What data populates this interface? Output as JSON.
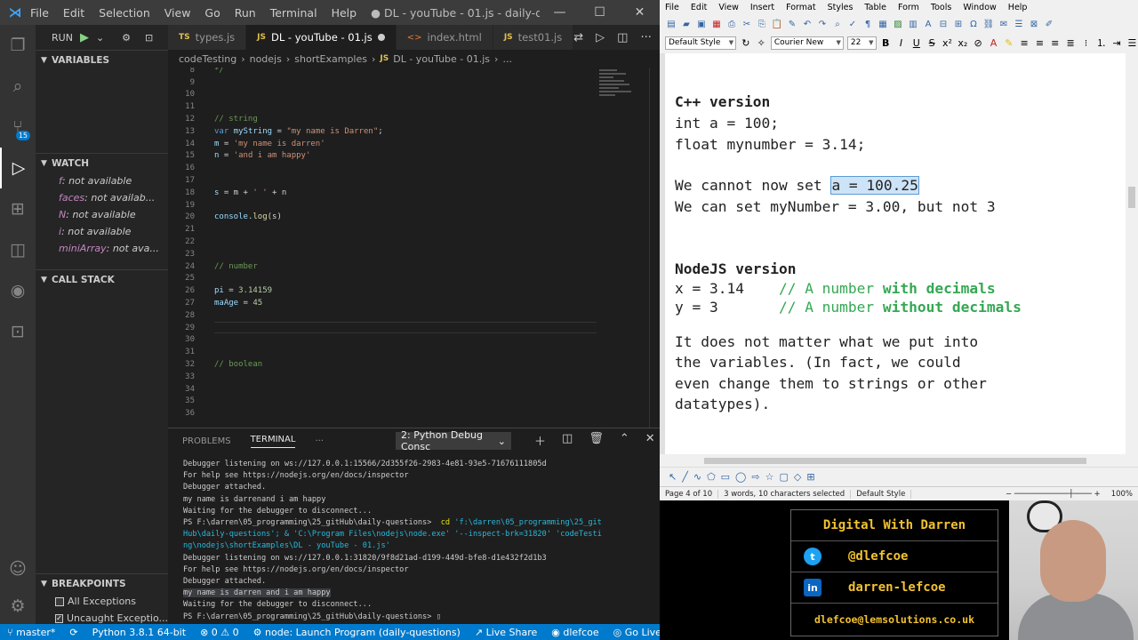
{
  "vscode": {
    "title": {
      "menus": [
        "File",
        "Edit",
        "Selection",
        "View",
        "Go",
        "Run",
        "Terminal",
        "Help"
      ],
      "window_title": "● DL - youTube - 01.js - daily-questions - Visual Studio ..."
    },
    "activity_badge": "15",
    "sidebar": {
      "run_label": "RUN",
      "variables_header": "VARIABLES",
      "watch_header": "WATCH",
      "watch_items": [
        {
          "name": "f",
          "value": "not available"
        },
        {
          "name": "faces",
          "value": "not availab..."
        },
        {
          "name": "N",
          "value": "not available"
        },
        {
          "name": "i",
          "value": "not available"
        },
        {
          "name": "miniArray",
          "value": "not ava..."
        }
      ],
      "callstack_header": "CALL STACK",
      "breakpoints_header": "BREAKPOINTS",
      "breakpoints": [
        {
          "label": "All Exceptions",
          "checked": false
        },
        {
          "label": "Uncaught Exceptio...",
          "checked": true
        }
      ]
    },
    "tabs": [
      {
        "label": "types.js",
        "icon": "TS",
        "active": false
      },
      {
        "label": "DL - youTube - 01.js",
        "icon": "JS",
        "active": true
      },
      {
        "label": "index.html",
        "icon": "<>",
        "active": false
      },
      {
        "label": "test01.js",
        "icon": "JS",
        "active": false
      }
    ],
    "breadcrumb": [
      "codeTesting",
      "nodejs",
      "shortExamples",
      "DL - youTube - 01.js",
      "..."
    ],
    "code_lines": [
      {
        "n": "8",
        "t": "*/",
        "c": "cmt"
      },
      {
        "n": "9",
        "t": "",
        "c": ""
      },
      {
        "n": "10",
        "t": "",
        "c": ""
      },
      {
        "n": "11",
        "t": "",
        "c": ""
      },
      {
        "n": "12",
        "t": "// string",
        "c": "cmt"
      },
      {
        "n": "13",
        "t": "var myString = \"my name is Darren\";",
        "c": "mix1"
      },
      {
        "n": "14",
        "t": "m = 'my name is darren'",
        "c": "mix2"
      },
      {
        "n": "15",
        "t": "n = 'and i am happy'",
        "c": "mix2"
      },
      {
        "n": "16",
        "t": "",
        "c": ""
      },
      {
        "n": "17",
        "t": "",
        "c": ""
      },
      {
        "n": "18",
        "t": "s = m + ' ' + n",
        "c": "mix3"
      },
      {
        "n": "19",
        "t": "",
        "c": ""
      },
      {
        "n": "20",
        "t": "console.log(s)",
        "c": "mix4"
      },
      {
        "n": "21",
        "t": "",
        "c": ""
      },
      {
        "n": "22",
        "t": "",
        "c": ""
      },
      {
        "n": "23",
        "t": "",
        "c": ""
      },
      {
        "n": "24",
        "t": "// number",
        "c": "cmt"
      },
      {
        "n": "25",
        "t": "",
        "c": ""
      },
      {
        "n": "26",
        "t": "pi = 3.14159",
        "c": "mix5"
      },
      {
        "n": "27",
        "t": "maAge = 45",
        "c": "mix5"
      },
      {
        "n": "28",
        "t": "",
        "c": ""
      },
      {
        "n": "29",
        "t": "",
        "c": "cur"
      },
      {
        "n": "30",
        "t": "",
        "c": ""
      },
      {
        "n": "31",
        "t": "",
        "c": ""
      },
      {
        "n": "32",
        "t": "// boolean",
        "c": "cmt"
      },
      {
        "n": "33",
        "t": "",
        "c": ""
      },
      {
        "n": "34",
        "t": "",
        "c": ""
      },
      {
        "n": "35",
        "t": "",
        "c": ""
      },
      {
        "n": "36",
        "t": "",
        "c": ""
      }
    ],
    "panel": {
      "tabs": [
        "PROBLEMS",
        "TERMINAL",
        "···"
      ],
      "active_tab": "TERMINAL",
      "console_select": "2: Python Debug Consc",
      "terminal_lines": [
        "Debugger listening on ws://127.0.0.1:15566/2d355f26-2983-4e81-93e5-71676111805d",
        "For help see https://nodejs.org/en/docs/inspector",
        "Debugger attached.",
        "my name is darrenand i am happy",
        "Waiting for the debugger to disconnect...",
        "PS F:\\darren\\05_programming\\25_gitHub\\daily-questions>  cd 'f:\\darren\\05_programming\\25_git",
        "Hub\\daily-questions'; & 'C:\\Program Files\\nodejs\\node.exe' '--inspect-brk=31820' 'codeTesti",
        "ng\\nodejs\\shortExamples\\DL - youTube - 01.js'",
        "Debugger listening on ws://127.0.0.1:31820/9f8d21ad-d199-449d-bfe8-d1e432f2d1b3",
        "For help see https://nodejs.org/en/docs/inspector",
        "Debugger attached.",
        "my name is darren and i am happy",
        "Waiting for the debugger to disconnect...",
        "PS F:\\darren\\05_programming\\25_gitHub\\daily-questions> "
      ]
    },
    "status": {
      "branch": "master*",
      "python": "Python 3.8.1 64-bit",
      "problems": "⊗ 0 ⚠ 0",
      "launch": "node: Launch Program (daily-questions)",
      "live_share": "Live Share",
      "user": "dlefcoe",
      "go_live": "Go Live"
    }
  },
  "writer": {
    "menus": [
      "File",
      "Edit",
      "View",
      "Insert",
      "Format",
      "Styles",
      "Table",
      "Form",
      "Tools",
      "Window",
      "Help"
    ],
    "para_style": "Default Style",
    "font_name": "Courier New",
    "font_size": "22",
    "doc": {
      "cpp_title": "C++ version",
      "cpp_line1": "int a = 100;",
      "cpp_line2": "float mynumber = 3.14;",
      "cannot_prefix": "We cannot now set ",
      "cannot_sel": "a = 100.25",
      "can_line": "We can set myNumber = 3.00, but not 3",
      "node_title": "NodeJS version",
      "node_x_code": "x = 3.14    ",
      "node_comment": "// A number ",
      "node_x_strong": "with decimals",
      "node_y_code": "y = 3       ",
      "node_y_strong": "without decimals",
      "para1": "It does not matter what we put into",
      "para2": "the variables. (In fact, we could",
      "para3": "even change them to strings or other",
      "para4": "datatypes)."
    },
    "status": {
      "page": "Page 4 of 10",
      "words": "3 words, 10 characters selected",
      "style": "Default Style",
      "zoom": "100%"
    }
  },
  "card": {
    "name": "Digital With Darren",
    "twitter": "@dlefcoe",
    "linkedin": "darren-lefcoe",
    "email": "dlefcoe@lemsolutions.co.uk"
  }
}
